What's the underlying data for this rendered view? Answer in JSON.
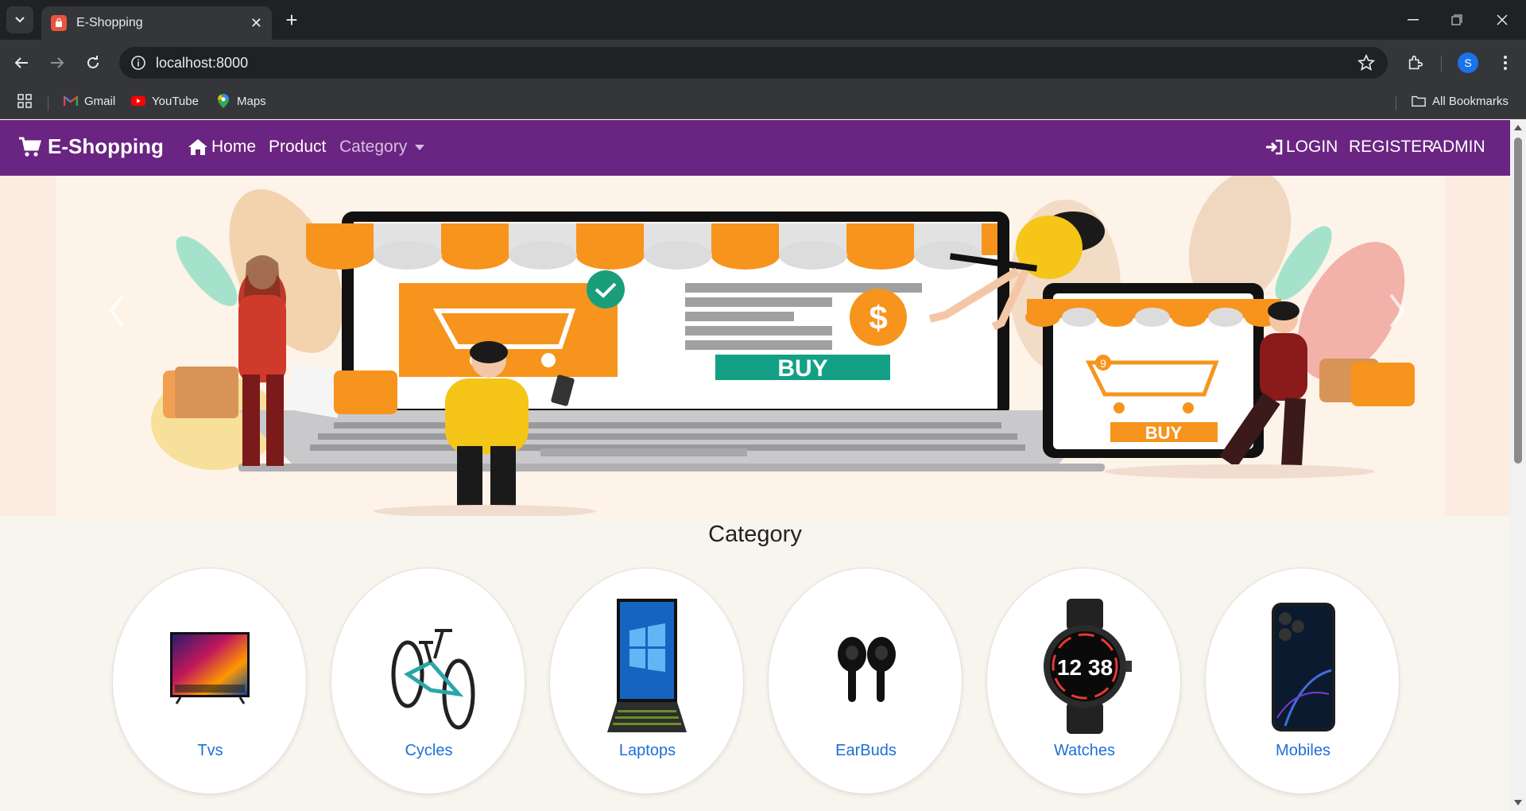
{
  "browser": {
    "tab_title": "E-Shopping",
    "url": "localhost:8000",
    "profile_initial": "S",
    "bookmarks": [
      {
        "label": "Gmail",
        "icon": "gmail-icon"
      },
      {
        "label": "YouTube",
        "icon": "youtube-icon"
      },
      {
        "label": "Maps",
        "icon": "maps-icon"
      }
    ],
    "all_bookmarks_label": "All Bookmarks"
  },
  "navbar": {
    "brand": "E-Shopping",
    "links": [
      "Home",
      "Product",
      "Category"
    ],
    "right_links": [
      "LOGIN",
      "REGISTER",
      "ADMIN"
    ],
    "bg_color": "#6a2481"
  },
  "hero": {
    "buy_label": "BUY",
    "phone_buy_label": "BUY",
    "dollar_sign": "$",
    "badge_count": "9"
  },
  "category": {
    "title": "Category",
    "items": [
      {
        "label": "Tvs",
        "icon": "tv-icon"
      },
      {
        "label": "Cycles",
        "icon": "bicycle-icon"
      },
      {
        "label": "Laptops",
        "icon": "laptop-icon"
      },
      {
        "label": "EarBuds",
        "icon": "earbuds-icon"
      },
      {
        "label": "Watches",
        "icon": "watch-icon"
      },
      {
        "label": "Mobiles",
        "icon": "mobile-icon"
      }
    ],
    "watch_time": "12 38"
  }
}
